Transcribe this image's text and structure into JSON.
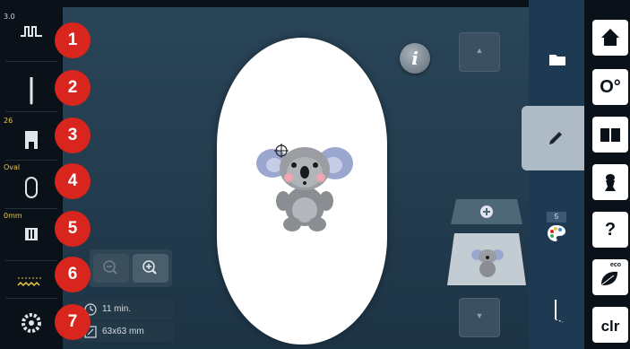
{
  "left_rail": {
    "stitch_top_tag": "3.0",
    "foot_tag": "26",
    "hoop_tag": "Oval",
    "feed_tag": "0mm"
  },
  "callouts": [
    "1",
    "2",
    "3",
    "4",
    "5",
    "6",
    "7"
  ],
  "main": {
    "info_label": "i",
    "scroll_up_glyph": "▲",
    "scroll_down_glyph": "▼",
    "zoom_out_icon": "zoom-out-icon",
    "zoom_in_icon": "zoom-in-icon",
    "stitch_time": "11 min.",
    "design_size": "63x63 mm",
    "preview_plus": "+"
  },
  "tabs": {
    "color_count": "5"
  },
  "right_buttons": {
    "home": "home-icon",
    "settings_glyph": "O°",
    "help_glyph": "?",
    "eco_label": "eco",
    "clr_label": "clr"
  },
  "colors": {
    "callout_red": "#d8261e",
    "accent_yellow": "#e8c640",
    "tab_blue": "#1e3a52",
    "active_tab": "#aebbc6"
  }
}
